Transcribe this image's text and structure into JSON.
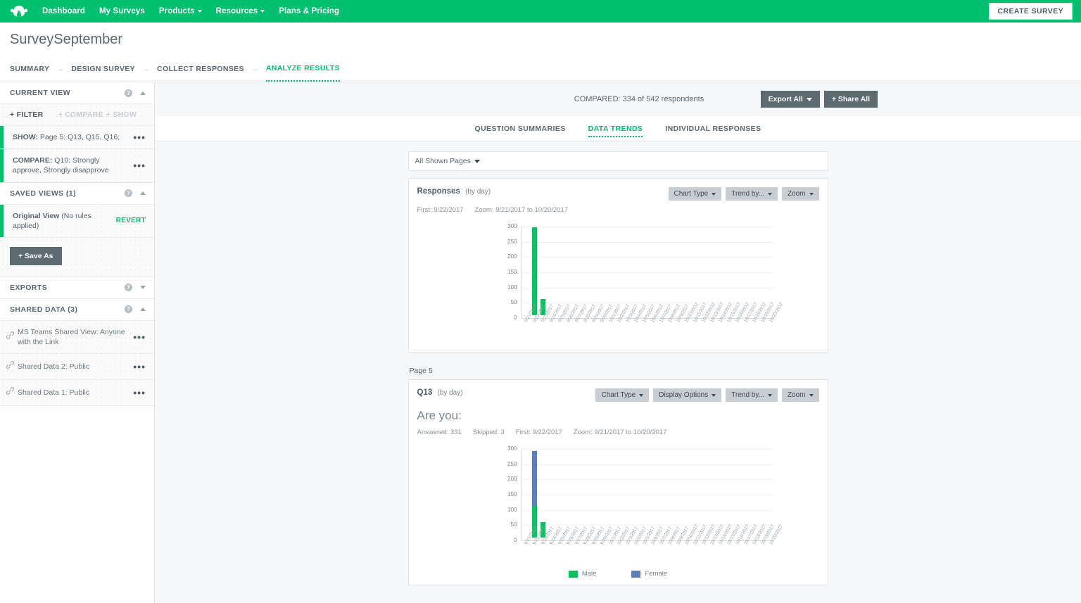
{
  "topnav": {
    "logo_icon": "surveymonkey-logo-icon",
    "items": [
      {
        "label": "Dashboard",
        "has_caret": false
      },
      {
        "label": "My Surveys",
        "has_caret": false
      },
      {
        "label": "Products",
        "has_caret": true
      },
      {
        "label": "Resources",
        "has_caret": true
      },
      {
        "label": "Plans & Pricing",
        "has_caret": false
      }
    ],
    "create_survey_label": "CREATE SURVEY"
  },
  "page": {
    "survey_title": "SurveySeptember",
    "breadcrumbs": [
      {
        "label": "SUMMARY",
        "active": false
      },
      {
        "label": "DESIGN SURVEY",
        "active": false
      },
      {
        "label": "COLLECT RESPONSES",
        "active": false
      },
      {
        "label": "ANALYZE RESULTS",
        "active": true
      }
    ]
  },
  "sidebar": {
    "current_view": {
      "title": "CURRENT VIEW",
      "filter_label": "+ FILTER",
      "compare_label": "+ COMPARE",
      "show_label": "+ SHOW",
      "rules": [
        {
          "prefix": "SHOW:",
          "text": " Page 5: Q13, Q15, Q16;"
        },
        {
          "prefix": "COMPARE:",
          "text": " Q10: Strongly approve, Strongly disapprove"
        }
      ]
    },
    "saved_views": {
      "title": "SAVED VIEWS (1)",
      "item_name": "Original View",
      "item_note": "(No rules applied)",
      "revert_label": "REVERT",
      "save_as_label": "+ Save As"
    },
    "exports": {
      "title": "EXPORTS"
    },
    "shared_data": {
      "title": "SHARED DATA (3)",
      "items": [
        {
          "label": "MS Teams Shared View: Anyone with the Link"
        },
        {
          "label": "Shared Data 2: Public"
        },
        {
          "label": "Shared Data 1: Public"
        }
      ]
    }
  },
  "main": {
    "compared_text": "COMPARED: 334 of 542 respondents",
    "export_all_label": "Export All",
    "share_all_label": "+ Share All",
    "tabs": [
      {
        "label": "QUESTION SUMMARIES",
        "active": false
      },
      {
        "label": "DATA TRENDS",
        "active": true
      },
      {
        "label": "INDIVIDUAL RESPONSES",
        "active": false
      }
    ],
    "pages_selector_label": "All Shown Pages",
    "page_label": "Page 5"
  },
  "cards": [
    {
      "title": "Responses",
      "subtitle": "(by day)",
      "buttons": [
        "Chart Type",
        "Trend by...",
        "Zoom"
      ],
      "meta": [
        "First: 9/22/2017",
        "Zoom: 9/21/2017 to 10/20/2017"
      ],
      "question": null
    },
    {
      "title": "Q13",
      "subtitle": "(by day)",
      "buttons": [
        "Chart Type",
        "Display Options",
        "Trend by...",
        "Zoom"
      ],
      "meta": [
        "Answered: 331",
        "Skipped: 3",
        "First: 9/22/2017",
        "Zoom: 9/21/2017 to 10/20/2017"
      ],
      "question": "Are you:"
    }
  ],
  "chart_data": [
    {
      "type": "bar",
      "title": "Responses (by day)",
      "xlabel": "",
      "ylabel": "",
      "ylim": [
        0,
        300
      ],
      "yticks": [
        0,
        50,
        100,
        150,
        200,
        250,
        300
      ],
      "grid": true,
      "legend": null,
      "categories": [
        "9/21/2017",
        "9/22/2017",
        "9/23/2017",
        "9/24/2017",
        "9/25/2017",
        "9/26/2017",
        "9/27/2017",
        "9/28/2017",
        "9/29/2017",
        "9/30/2017",
        "10/1/2017",
        "10/2/2017",
        "10/3/2017",
        "10/4/2017",
        "10/5/2017",
        "10/6/2017",
        "10/7/2017",
        "10/8/2017",
        "10/9/2017",
        "10/10/2017",
        "10/11/2017",
        "10/12/2017",
        "10/13/2017",
        "10/14/2017",
        "10/15/2017",
        "10/16/2017",
        "10/17/2017",
        "10/18/2017",
        "10/19/2017",
        "10/20/2017"
      ],
      "series": [
        {
          "name": "Responses",
          "color": "#0fbf62",
          "values": [
            0,
            288,
            52,
            0,
            0,
            0,
            0,
            0,
            0,
            0,
            0,
            0,
            0,
            0,
            0,
            0,
            0,
            0,
            0,
            0,
            0,
            0,
            0,
            0,
            0,
            0,
            0,
            0,
            0,
            0
          ]
        }
      ]
    },
    {
      "type": "bar",
      "stacked": true,
      "title": "Q13 (by day) — Are you:",
      "xlabel": "",
      "ylabel": "",
      "ylim": [
        0,
        300
      ],
      "yticks": [
        0,
        50,
        100,
        150,
        200,
        250,
        300
      ],
      "grid": true,
      "legend": "bottom",
      "categories": [
        "9/21/2017",
        "9/22/2017",
        "9/23/2017",
        "9/24/2017",
        "9/25/2017",
        "9/26/2017",
        "9/27/2017",
        "9/28/2017",
        "9/29/2017",
        "9/30/2017",
        "10/1/2017",
        "10/2/2017",
        "10/3/2017",
        "10/4/2017",
        "10/5/2017",
        "10/6/2017",
        "10/7/2017",
        "10/8/2017",
        "10/9/2017",
        "10/10/2017",
        "10/11/2017",
        "10/12/2017",
        "10/13/2017",
        "10/14/2017",
        "10/15/2017",
        "10/16/2017",
        "10/17/2017",
        "10/18/2017",
        "10/19/2017",
        "10/20/2017"
      ],
      "series": [
        {
          "name": "Male",
          "color": "#0fbf62",
          "values": [
            0,
            105,
            50,
            0,
            0,
            0,
            0,
            0,
            0,
            0,
            0,
            0,
            0,
            0,
            0,
            0,
            0,
            0,
            0,
            0,
            0,
            0,
            0,
            0,
            0,
            0,
            0,
            0,
            0,
            0
          ]
        },
        {
          "name": "Female",
          "color": "#5b7fb9",
          "values": [
            0,
            180,
            0,
            0,
            0,
            0,
            0,
            0,
            0,
            0,
            0,
            0,
            0,
            0,
            0,
            0,
            0,
            0,
            0,
            0,
            0,
            0,
            0,
            0,
            0,
            0,
            0,
            0,
            0,
            0
          ]
        }
      ]
    }
  ],
  "colors": {
    "brand_green": "#00bf6f",
    "series_green": "#0fbf62",
    "series_blue": "#5b7fb9",
    "gray_button": "#5e6a72",
    "chart_button": "#c9ced2"
  }
}
